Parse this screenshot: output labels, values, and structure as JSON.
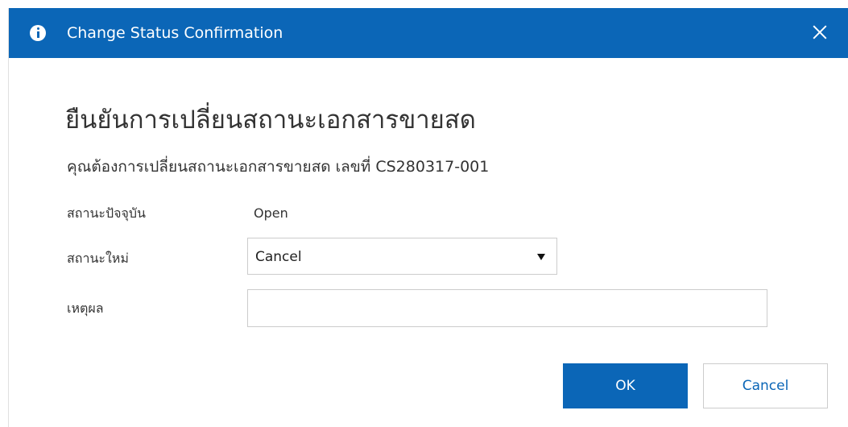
{
  "dialog": {
    "title": "Change Status Confirmation",
    "heading": "ยืนยันการเปลี่ยนสถานะเอกสารขายสด",
    "message": "คุณต้องการเปลี่ยนสถานะเอกสารขายสด เลขที่ CS280317-001"
  },
  "form": {
    "current_status_label": "สถานะปัจจุบัน",
    "current_status_value": "Open",
    "new_status_label": "สถานะใหม่",
    "new_status_value": "Cancel",
    "reason_label": "เหตุผล",
    "reason_value": ""
  },
  "buttons": {
    "ok_label": "OK",
    "cancel_label": "Cancel"
  },
  "colors": {
    "header_bg": "#0b66b7",
    "primary": "#0b66b7"
  },
  "icons": {
    "header_icon": "info-icon",
    "close_icon": "close-icon",
    "dropdown_icon": "chevron-down-icon"
  }
}
